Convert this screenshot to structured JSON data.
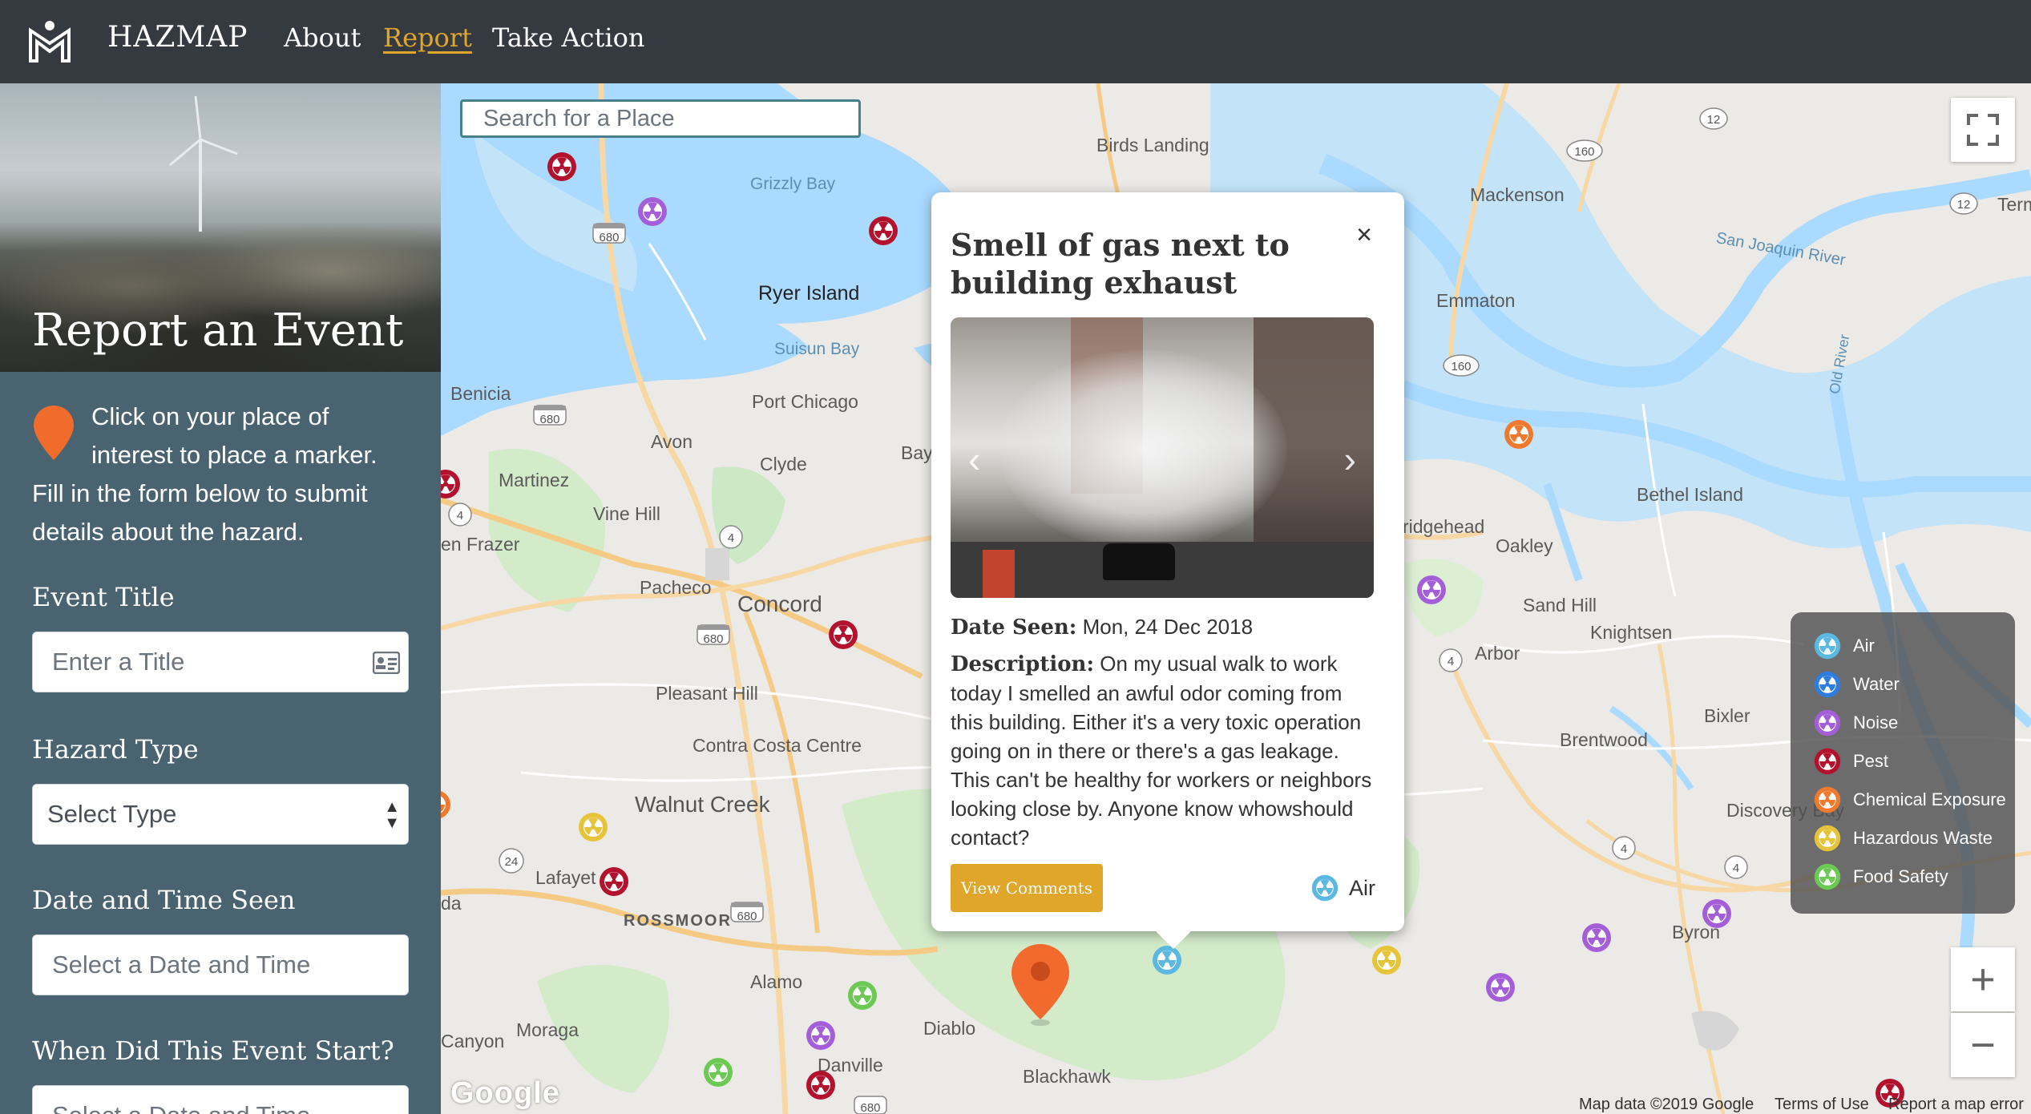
{
  "nav": {
    "brand": "HAZMAP",
    "links": [
      {
        "label": "About",
        "active": false
      },
      {
        "label": "Report",
        "active": true
      },
      {
        "label": "Take Action",
        "active": false
      }
    ]
  },
  "sidebar": {
    "heading": "Report an Event",
    "intro_line1": "Click on your place of interest to place a marker.",
    "intro_line2": "Fill in the form below to submit details about the hazard.",
    "event_title_label": "Event Title",
    "event_title_placeholder": "Enter a Title",
    "hazard_type_label": "Hazard Type",
    "hazard_type_value": "Select Type",
    "date_seen_label": "Date and Time Seen",
    "date_seen_placeholder": "Select a Date and Time",
    "event_start_label": "When Did This Event Start?",
    "event_start_placeholder": "Select a Date and Time"
  },
  "map": {
    "search_placeholder": "Search for a Place",
    "places": {
      "birds_landing": "Birds Landing",
      "grizzly_bay": "Grizzly Bay",
      "mackenson": "Mackenson",
      "term": "Term",
      "san_joaquin_river": "San Joaquin River",
      "ryer_island": "Ryer Island",
      "emmaton": "Emmaton",
      "suisun_bay": "Suisun Bay",
      "benicia": "Benicia",
      "port_chicago": "Port Chicago",
      "old_river": "Old River",
      "avon": "Avon",
      "clyde": "Clyde",
      "bay": "Bay",
      "martinez": "Martinez",
      "bethel_island": "Bethel Island",
      "vine_hill": "Vine Hill",
      "bridgehead": "ridgehead",
      "oakley": "Oakley",
      "frazer": "en Frazer",
      "pacheco": "Pacheco",
      "concord": "Concord",
      "sand_hill": "Sand Hill",
      "knightsen": "Knightsen",
      "arbor": "Arbor",
      "pleasant_hill": "Pleasant Hill",
      "bixler": "Bixler",
      "contra_costa_centre": "Contra Costa Centre",
      "brentwood": "Brentwood",
      "walnut_creek": "Walnut Creek",
      "discovery_bay": "Discovery Bay",
      "lafayette": "Lafayet",
      "rossmoor": "ROSSMOOR",
      "byron": "Byron",
      "orinda": "da",
      "alamo": "Alamo",
      "diablo": "Diablo",
      "moraga": "Moraga",
      "canyon": "Canyon",
      "danville": "Danville",
      "blackhawk": "Blackhawk"
    },
    "legend": [
      {
        "label": "Air",
        "color": "#5bb8e0"
      },
      {
        "label": "Water",
        "color": "#2f7de1"
      },
      {
        "label": "Noise",
        "color": "#a45fd8"
      },
      {
        "label": "Pest",
        "color": "#b3122f"
      },
      {
        "label": "Chemical Exposure",
        "color": "#ef7a2d"
      },
      {
        "label": "Hazardous Waste",
        "color": "#e6c43a"
      },
      {
        "label": "Food Safety",
        "color": "#6cc954"
      }
    ],
    "zoom_in": "+",
    "zoom_out": "−",
    "google": "Google",
    "attribution": "Map data ©2019 Google",
    "terms": "Terms of Use",
    "report_error": "Report a map error",
    "shields": {
      "s680": "680",
      "s4": "4",
      "s24": "24",
      "s160": "160",
      "s12": "12"
    }
  },
  "popup": {
    "title": "Smell of gas next to building exhaust",
    "close": "×",
    "date_label": "Date Seen:",
    "date_value": "Mon, 24 Dec 2018",
    "description_label": "Description:",
    "description": "On my usual walk to work today I smelled an awful odor coming from this building. Either it's a very toxic operation going on in there or there's a gas leakage. This can't be healthy for workers or neighbors looking close by. Anyone know whowshould contact?",
    "button": "View Comments",
    "category": "Air",
    "prev": "‹",
    "next": "›"
  }
}
